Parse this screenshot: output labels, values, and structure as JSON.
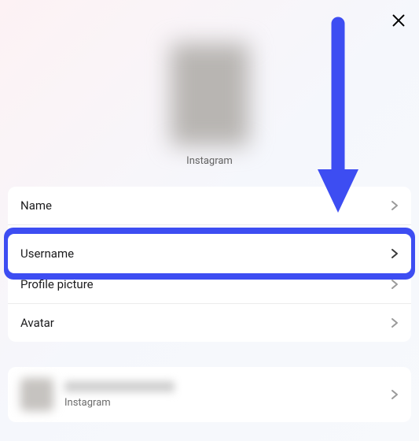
{
  "close_icon": "close",
  "profile": {
    "caption": "Instagram"
  },
  "rows": {
    "name": "Name",
    "username": "Username",
    "profile_picture": "Profile picture",
    "avatar": "Avatar"
  },
  "account": {
    "platform": "Instagram"
  },
  "annotation": {
    "highlight_color": "#3d4df2"
  }
}
